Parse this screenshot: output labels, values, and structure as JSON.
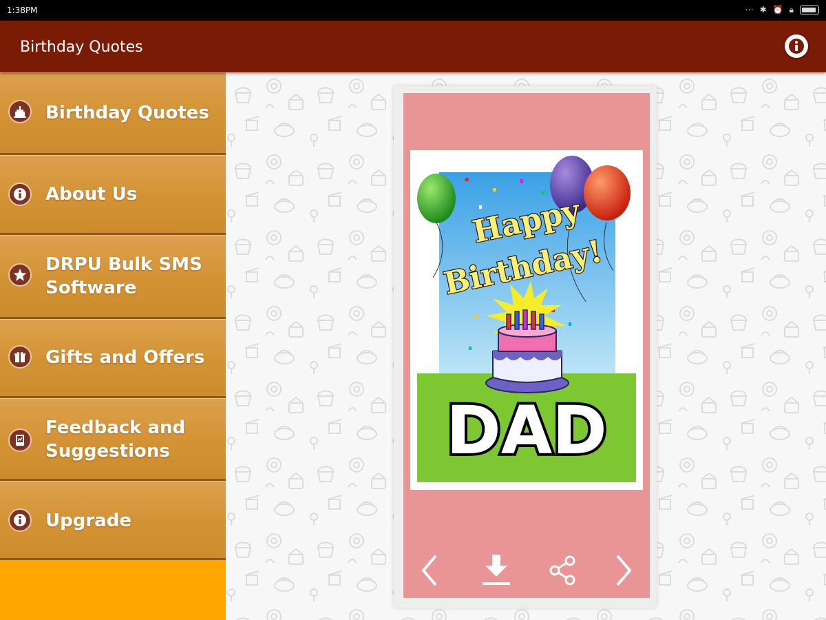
{
  "status_bar": {
    "time": "1:38PM",
    "icons": [
      "more-icon",
      "bluetooth-icon",
      "alarm-icon",
      "lock-icon",
      "battery-icon"
    ]
  },
  "app_bar": {
    "title": "Birthday Quotes",
    "info_icon": "info-icon"
  },
  "drawer": {
    "items": [
      {
        "label": "Birthday Quotes",
        "icon": "cake-icon"
      },
      {
        "label": "About Us",
        "icon": "info-icon"
      },
      {
        "label_line1": "DRPU Bulk SMS",
        "label_line2": "Software",
        "icon": "star-icon"
      },
      {
        "label": "Gifts and Offers",
        "icon": "gift-icon"
      },
      {
        "label_line1": "Feedback and",
        "label_line2": "Suggestions",
        "icon": "feedback-icon"
      },
      {
        "label": "Upgrade",
        "icon": "info-icon"
      }
    ]
  },
  "card": {
    "line1": "Happy",
    "line2": "Birthday!",
    "name": "DAD",
    "controls": [
      "previous-icon",
      "download-icon",
      "share-icon",
      "next-icon"
    ]
  },
  "colors": {
    "app_bar": "#7a1b06",
    "drawer_fill": "#ffa500",
    "drawer_item": "#d49436",
    "card_bg": "#e99595",
    "green_ground": "#7dc832",
    "sky_top": "#3aa0e6"
  }
}
